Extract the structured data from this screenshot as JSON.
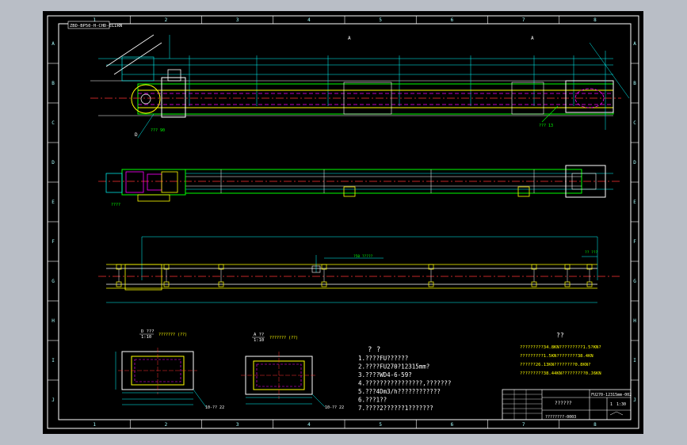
{
  "drawing": {
    "code_stamp": "ZBD-BP50-H-CHD-ELIRN",
    "border_columns": [
      "1",
      "2",
      "3",
      "4",
      "5",
      "6",
      "7",
      "8"
    ],
    "border_rows": [
      "A",
      "B",
      "C",
      "D",
      "E",
      "F",
      "G",
      "H",
      "I",
      "J"
    ],
    "section_marks": [
      "A",
      "A",
      "D"
    ],
    "part_tags": [
      "??? 90",
      "??? 13",
      "????",
      "CH-???",
      "?50 ?????",
      "?? ???"
    ],
    "detail_a": {
      "title": "D ???",
      "scale": "1:10",
      "caption": "??????? (??)",
      "tag": "10-?? 22"
    },
    "detail_b": {
      "title": "A ??",
      "scale": "1:10",
      "caption": "??????? (??)",
      "tag": "10-?? 22"
    },
    "notes_title": "? ?",
    "notes": [
      "1.????FU??????",
      "2.????FU270?12315mm?",
      "3.????WD4-6-59?",
      "4.????????????????,???????",
      "5.???4Dm3/h????????????",
      "6.???1??",
      "7.????2??????1???????"
    ],
    "params_title": "??",
    "params": [
      "?????????34.8KN?????????1.5?KN?",
      "?????????1.5KN????????38.4KN",
      "??????26.13KN????????0.8KN?",
      "?????????38.44KN?????????0.J6KN"
    ],
    "title_block": {
      "drawing_no": "FU270-12315mm-002",
      "name": "??????",
      "part_no": "????????-0003",
      "sheet": "1",
      "scale": "1:30"
    }
  }
}
